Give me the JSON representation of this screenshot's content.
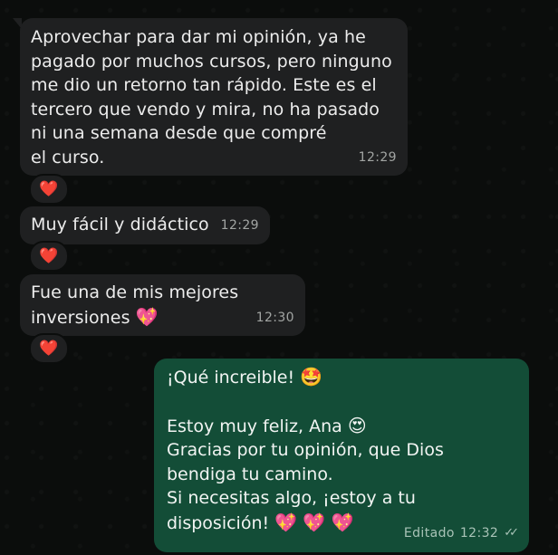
{
  "messages": [
    {
      "text": "Aprovechar para dar mi opinión, ya he\npagado por muchos cursos, pero ninguno\nme dio un retorno tan rápido. Este es el\ntercero que vendo y mira, no ha pasado\nni una semana desde que compré\nel curso.",
      "time": "12:29",
      "reaction": "❤️"
    },
    {
      "text": "Muy fácil y didáctico",
      "time": "12:29",
      "reaction": "❤️"
    },
    {
      "text": "Fue una de mis mejores\ninversiones",
      "emoji": "💖",
      "time": "12:30",
      "reaction": "❤️"
    }
  ],
  "reply": {
    "line1": "¡Qué increible!",
    "emoji1": "🤩",
    "line2": "Estoy muy feliz, Ana",
    "emoji2": "😍",
    "body": "Gracias por tu opinión, que Dios\nbendiga tu camino.\nSi necesitas algo, ¡estoy a tu",
    "last": "disposición!",
    "emoji3": "💖 💖 💖",
    "edited": "Editado",
    "time": "12:32",
    "ticks": "✓✓"
  }
}
